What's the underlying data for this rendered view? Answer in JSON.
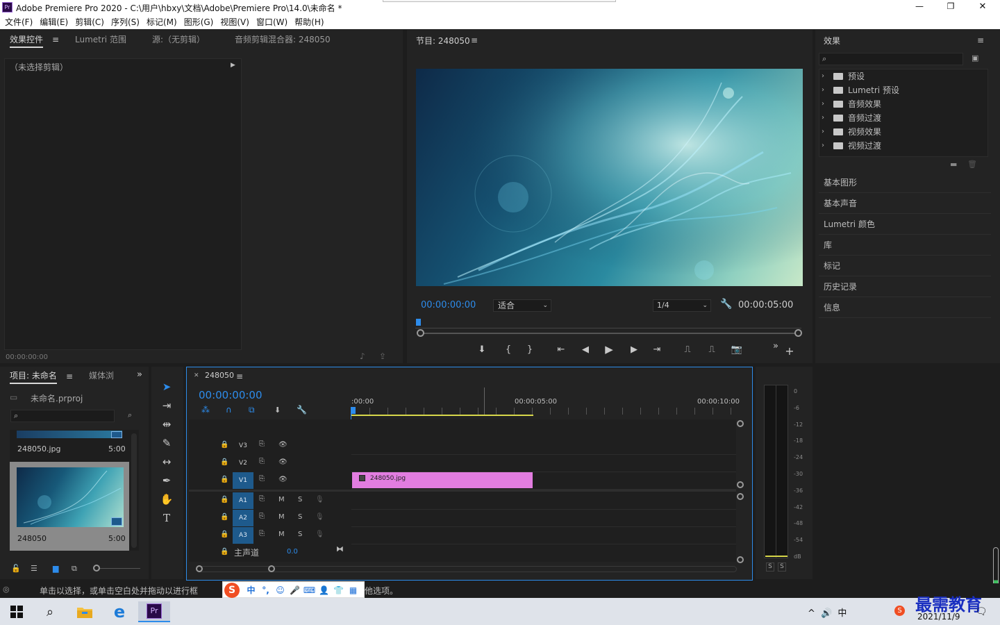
{
  "window": {
    "title": "Adobe Premiere Pro 2020 - C:\\用户\\hbxy\\文档\\Adobe\\Premiere Pro\\14.0\\未命名 *",
    "app_icon": "Pr",
    "minimize": "—",
    "maximize": "❐",
    "close": "✕"
  },
  "menu": [
    "文件(F)",
    "编辑(E)",
    "剪辑(C)",
    "序列(S)",
    "标记(M)",
    "图形(G)",
    "视图(V)",
    "窗口(W)",
    "帮助(H)"
  ],
  "source_panel": {
    "tabs": [
      "效果控件",
      "Lumetri 范围",
      "源:（无剪辑）",
      "音频剪辑混合器: 248050"
    ],
    "no_clip": "（未选择剪辑）",
    "timecode": "00:00:00:00"
  },
  "program_monitor": {
    "title": "节目: 248050",
    "timecode": "00:00:00:00",
    "fit": "适合",
    "resolution": "1/4",
    "duration": "00:00:05:00"
  },
  "effects_panel": {
    "title": "效果",
    "tree": [
      "预设",
      "Lumetri 预设",
      "音频效果",
      "音频过渡",
      "视频效果",
      "视频过渡"
    ],
    "panels": [
      "基本图形",
      "基本声音",
      "Lumetri 颜色",
      "库",
      "标记",
      "历史记录",
      "信息"
    ]
  },
  "project_panel": {
    "tabs": [
      "项目: 未命名",
      "媒体浏"
    ],
    "project_file": "未命名.prproj",
    "items": [
      {
        "name": "248050.jpg",
        "duration": "5:00"
      },
      {
        "name": "248050",
        "duration": "5:00"
      }
    ]
  },
  "timeline": {
    "sequence": "248050",
    "timecode": "00:00:00:00",
    "ruler": [
      ":00:00",
      "00:00:05:00",
      "00:00:10:00"
    ],
    "video_tracks": [
      "V3",
      "V2",
      "V1"
    ],
    "audio_tracks": [
      "A1",
      "A2",
      "A3"
    ],
    "track_m": "M",
    "track_s": "S",
    "master": "主声道",
    "master_value": "0.0",
    "clip_name": "248050.jpg"
  },
  "audio_meter": {
    "scale": [
      "0",
      "-6",
      "-12",
      "-18",
      "-24",
      "-30",
      "-36",
      "-42",
      "-48",
      "-54",
      "dB"
    ],
    "solo": [
      "S",
      "S"
    ]
  },
  "status_bar": {
    "text_left": "单击以选择，或单击空白处并拖动以进行框",
    "text_right": "他选项。"
  },
  "ime_bar": [
    "中",
    "°,",
    "☺",
    "🎤",
    "⌨",
    "👤",
    "👕",
    "▦"
  ],
  "taskbar": {
    "date": "2021/11/9",
    "tray": "^ 🔊 中",
    "pr_label": "Pr",
    "watermark": "最需教育"
  },
  "colors": {
    "accent_blue": "#2d8ceb",
    "clip": "#e27de0",
    "bg": "#1d1d1d",
    "panel": "#232323"
  }
}
